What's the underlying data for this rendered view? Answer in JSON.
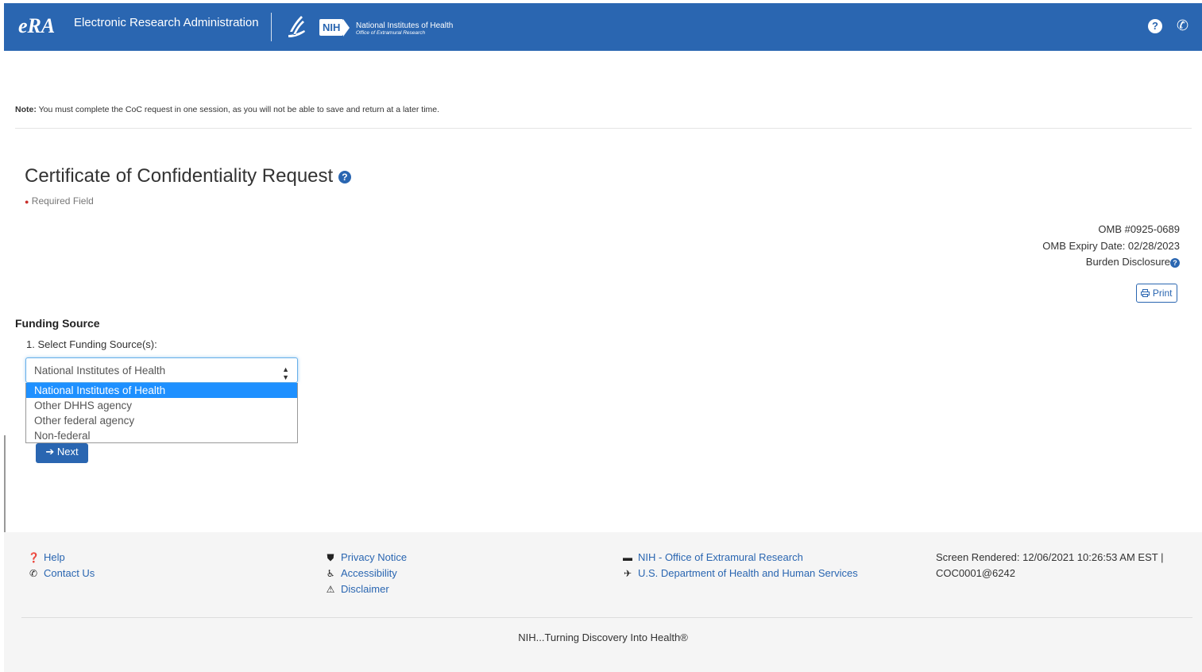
{
  "header": {
    "logo": "eRA",
    "app_title": "Electronic Research Administration",
    "nih_badge": "NIH",
    "nih_name": "National Institutes of Health",
    "nih_office": "Office of Extramural Research",
    "help_glyph": "?",
    "phone_glyph": "✆"
  },
  "note": {
    "label": "Note:",
    "text": " You must complete the CoC request in one session, as you will not be able to save and return at a later time."
  },
  "page": {
    "title": "Certificate of Confidentiality Request",
    "required": "Required Field"
  },
  "omb": {
    "number": "OMB #0925-0689",
    "expiry": "OMB Expiry Date: 02/28/2023",
    "burden": "Burden Disclosure"
  },
  "print_label": "Print",
  "funding": {
    "section_title": "Funding Source",
    "question": "1. Select Funding Source(s):",
    "selected": "National Institutes of Health",
    "options": [
      "National Institutes of Health",
      "Other DHHS agency",
      "Other federal agency",
      "Non-federal"
    ]
  },
  "next_label": "Next",
  "footer": {
    "help": "Help",
    "contact": "Contact Us",
    "privacy": "Privacy Notice",
    "accessibility": "Accessibility",
    "disclaimer": "Disclaimer",
    "nih_oer": "NIH - Office of Extramural Research",
    "hhs": "U.S. Department of Health and Human Services",
    "rendered_line1": "Screen Rendered: 12/06/2021 10:26:53 AM EST |",
    "rendered_line2": "COC0001@6242",
    "tagline": "NIH...Turning Discovery Into Health®"
  },
  "icons": {
    "header_help": "question-circle-icon",
    "header_phone": "phone-icon",
    "print": "printer-icon",
    "next": "arrow-right-icon"
  },
  "colors": {
    "brand": "#2a66b1",
    "selected_option": "#1e90ff",
    "required": "#c9302c"
  }
}
